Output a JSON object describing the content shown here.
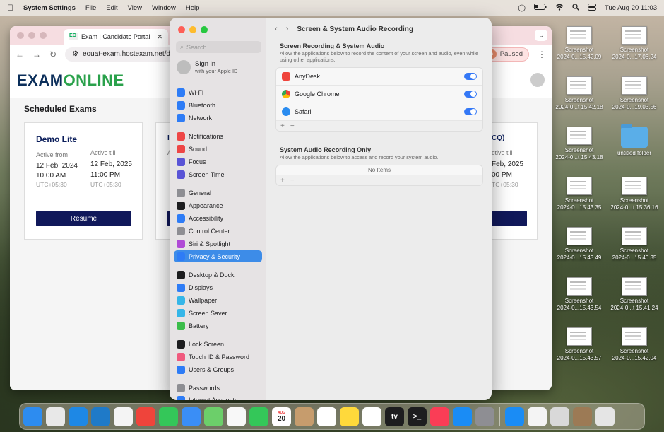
{
  "menubar": {
    "app": "System Settings",
    "items": [
      "File",
      "Edit",
      "View",
      "Window",
      "Help"
    ],
    "clock": "Tue Aug 20  11:03"
  },
  "browser": {
    "tab_title": "Exam | Candidate Portal",
    "tab_favicon": "EO",
    "url": "eouat-exam.hostexam.net/das",
    "paused": "Paused",
    "paused_avatar": "S"
  },
  "portal": {
    "logo_a": "EXAM",
    "logo_b": "ONLINE",
    "section": "Scheduled Exams",
    "card1": {
      "title": "Demo Lite",
      "from_label": "Active from",
      "till_label": "Active till",
      "from_date": "12 Feb, 2024",
      "till_date": "12 Feb, 2025",
      "from_time": "10:00 AM",
      "till_time": "11:00 PM",
      "tz1": "UTC+05:30",
      "tz2": "UTC+05:30",
      "button": "Resume"
    },
    "card3": {
      "title_frag": "CQ)",
      "till_label": "ctive till",
      "till_date": "Feb, 2025",
      "till_time": "00 PM",
      "tz": "TC+05:30"
    },
    "card2": {
      "frag1": "I",
      "frag2": "A"
    }
  },
  "settings": {
    "search_placeholder": "Search",
    "signin": "Sign in",
    "signin_sub": "with your Apple ID",
    "sidebar": [
      {
        "label": "Wi-Fi",
        "icon": "wifi-icon",
        "color": "#2e7cf6"
      },
      {
        "label": "Bluetooth",
        "icon": "bluetooth-icon",
        "color": "#2e7cf6"
      },
      {
        "label": "Network",
        "icon": "network-icon",
        "color": "#2e7cf6"
      },
      {
        "label": "Notifications",
        "icon": "notifications-icon",
        "color": "#ee4646"
      },
      {
        "label": "Sound",
        "icon": "sound-icon",
        "color": "#ee4646"
      },
      {
        "label": "Focus",
        "icon": "focus-icon",
        "color": "#5a54d6"
      },
      {
        "label": "Screen Time",
        "icon": "screen-time-icon",
        "color": "#5a54d6"
      },
      {
        "label": "General",
        "icon": "general-icon",
        "color": "#8e8e93"
      },
      {
        "label": "Appearance",
        "icon": "appearance-icon",
        "color": "#1d1d1f"
      },
      {
        "label": "Accessibility",
        "icon": "accessibility-icon",
        "color": "#2e7cf6"
      },
      {
        "label": "Control Center",
        "icon": "control-center-icon",
        "color": "#8e8e93"
      },
      {
        "label": "Siri & Spotlight",
        "icon": "siri-icon",
        "color": "#b04ad6"
      },
      {
        "label": "Privacy & Security",
        "icon": "privacy-icon",
        "color": "#2e7cf6"
      },
      {
        "label": "Desktop & Dock",
        "icon": "desktop-dock-icon",
        "color": "#1d1d1f"
      },
      {
        "label": "Displays",
        "icon": "displays-icon",
        "color": "#2e7cf6"
      },
      {
        "label": "Wallpaper",
        "icon": "wallpaper-icon",
        "color": "#35b6e8"
      },
      {
        "label": "Screen Saver",
        "icon": "screen-saver-icon",
        "color": "#35b6e8"
      },
      {
        "label": "Battery",
        "icon": "battery-icon",
        "color": "#3bbd4a"
      },
      {
        "label": "Lock Screen",
        "icon": "lock-screen-icon",
        "color": "#1d1d1f"
      },
      {
        "label": "Touch ID & Password",
        "icon": "touch-id-icon",
        "color": "#f05a7e"
      },
      {
        "label": "Users & Groups",
        "icon": "users-icon",
        "color": "#2e7cf6"
      },
      {
        "label": "Passwords",
        "icon": "passwords-icon",
        "color": "#8e8e93"
      },
      {
        "label": "Internet Accounts",
        "icon": "internet-accounts-icon",
        "color": "#2e7cf6"
      }
    ],
    "title": "Screen & System Audio Recording",
    "sec1_title": "Screen Recording & System Audio",
    "sec1_desc": "Allow the applications below to record the content of your screen and audio, even while using other applications.",
    "apps": [
      {
        "name": "AnyDesk",
        "color": "#ef443b",
        "enabled": true
      },
      {
        "name": "Google Chrome",
        "color": "#f4b400",
        "enabled": true
      },
      {
        "name": "Safari",
        "color": "#2a8cf0",
        "enabled": true
      }
    ],
    "sec2_title": "System Audio Recording Only",
    "sec2_desc": "Allow the applications below to access and record your system audio.",
    "no_items": "No Items",
    "plus": "+",
    "minus": "−"
  },
  "desktop": [
    {
      "l1": "Screenshot",
      "l2": "2024-0...15.42.09"
    },
    {
      "l1": "Screenshot",
      "l2": "2024-0...17.06.24"
    },
    {
      "l1": "Screenshot",
      "l2": "2024-0...t 15.42.18"
    },
    {
      "l1": "Screenshot",
      "l2": "2024-0...19.03.56"
    },
    {
      "l1": "Screenshot",
      "l2": "2024-0...t 15.43.18"
    },
    {
      "l1": "untitled folder",
      "l2": ""
    },
    {
      "l1": "Screenshot",
      "l2": "2024-0...15.43.35"
    },
    {
      "l1": "Screenshot",
      "l2": "2024-0...t 15.36.16"
    },
    {
      "l1": "Screenshot",
      "l2": "2024-0...15.43.49"
    },
    {
      "l1": "Screenshot",
      "l2": "2024-0...15.40.35"
    },
    {
      "l1": "Screenshot",
      "l2": "2024-0...15.43.54"
    },
    {
      "l1": "Screenshot",
      "l2": "2024-0...t 15.41.24"
    },
    {
      "l1": "Screenshot",
      "l2": "2024-0...15.43.57"
    },
    {
      "l1": "Screenshot",
      "l2": "2024-0...15.42.04"
    }
  ],
  "dock": [
    {
      "icon": "finder-icon",
      "color": "#2d8cf0"
    },
    {
      "icon": "launchpad-icon",
      "color": "#e8e8e8"
    },
    {
      "icon": "safari-icon",
      "color": "#1e88e5"
    },
    {
      "icon": "vscode-icon",
      "color": "#1f7ac8"
    },
    {
      "icon": "chrome-icon",
      "color": "#f4f4f4"
    },
    {
      "icon": "anydesk-icon",
      "color": "#ef443b"
    },
    {
      "icon": "messages-icon",
      "color": "#34c759"
    },
    {
      "icon": "mail-icon",
      "color": "#3a8ef6"
    },
    {
      "icon": "maps-icon",
      "color": "#6ccf6a"
    },
    {
      "icon": "photos-icon",
      "color": "#f8f8f8"
    },
    {
      "icon": "facetime-icon",
      "color": "#34c759"
    },
    {
      "icon": "calendar-icon",
      "color": "#ffffff",
      "text": "20",
      "sub": "AUG"
    },
    {
      "icon": "contacts-icon",
      "color": "#c69c6d"
    },
    {
      "icon": "reminders-icon",
      "color": "#ffffff"
    },
    {
      "icon": "notes-icon",
      "color": "#ffd93b"
    },
    {
      "icon": "freeform-icon",
      "color": "#ffffff"
    },
    {
      "icon": "tv-icon",
      "color": "#1d1d1f",
      "text": "tv"
    },
    {
      "icon": "terminal-icon",
      "color": "#1d1d1f",
      "text": ">_"
    },
    {
      "icon": "music-icon",
      "color": "#fa3d56"
    },
    {
      "icon": "app-store-icon",
      "color": "#1a8cf5"
    },
    {
      "icon": "system-settings-icon",
      "color": "#8e8e93"
    },
    {
      "icon": "location-icon",
      "color": "#1a8cf5"
    },
    {
      "icon": "textedit-icon",
      "color": "#f4f4f4"
    },
    {
      "icon": "preview-icon",
      "color": "#d9d9d9"
    },
    {
      "icon": "photo-thumb-icon",
      "color": "#9c7a55"
    },
    {
      "icon": "trash-icon",
      "color": "#e5e5e5"
    }
  ]
}
